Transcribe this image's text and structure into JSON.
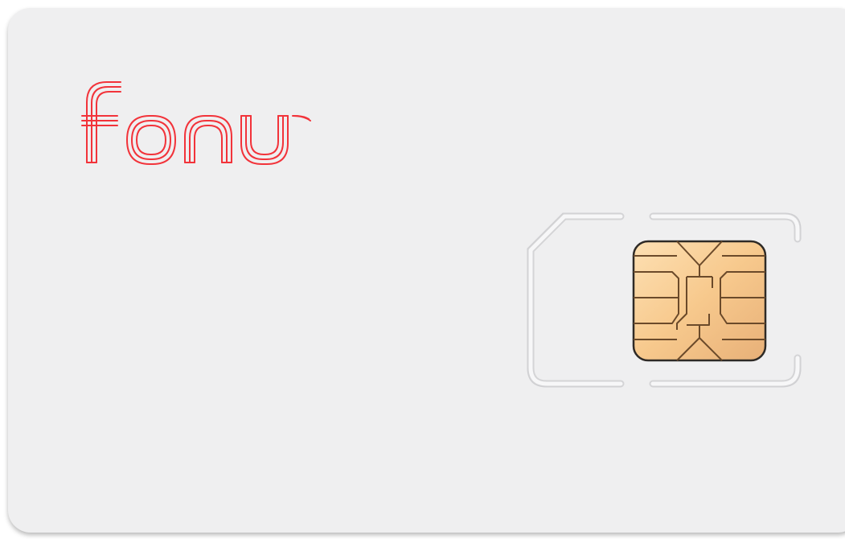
{
  "brand": {
    "name": "fonus",
    "color": "#f2333a"
  },
  "card": {
    "background": "#efeff0",
    "kind": "SIM card"
  },
  "chip": {
    "icon": "sim-chip-icon",
    "color_light": "#fbd9a8",
    "color_dark": "#e7b37a"
  }
}
